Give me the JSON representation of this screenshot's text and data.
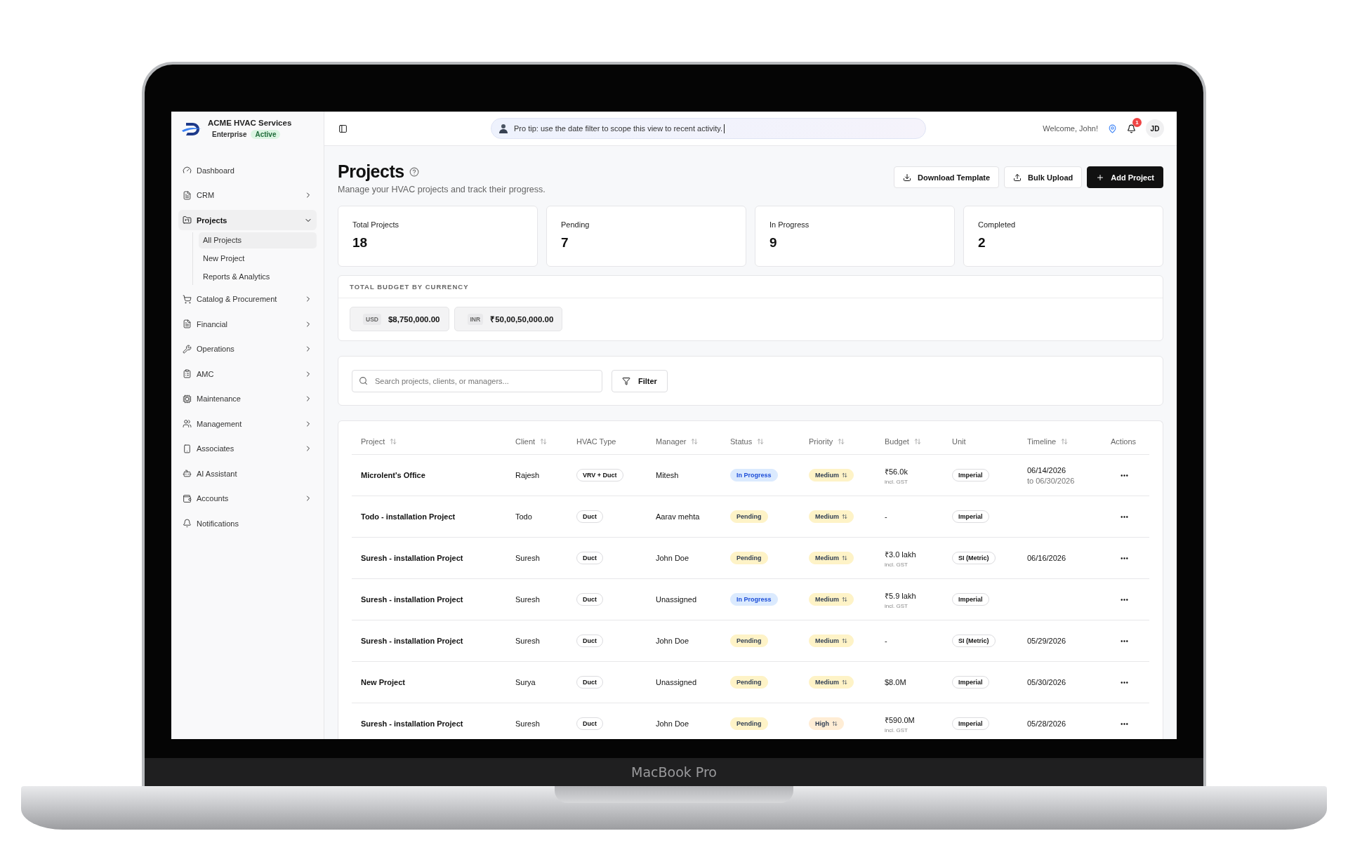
{
  "device": {
    "label": "MacBook Pro"
  },
  "sidebar": {
    "brand": {
      "name": "ACME HVAC Services",
      "plan": "Enterprise",
      "status": "Active"
    },
    "items": [
      {
        "label": "Dashboard",
        "kind": "link"
      },
      {
        "label": "CRM",
        "kind": "group",
        "expanded": false
      },
      {
        "label": "Projects",
        "kind": "group",
        "expanded": true,
        "children": [
          {
            "label": "All Projects",
            "selected": true
          },
          {
            "label": "New Project",
            "selected": false
          },
          {
            "label": "Reports & Analytics",
            "selected": false
          }
        ]
      },
      {
        "label": "Catalog & Procurement",
        "kind": "group",
        "expanded": false
      },
      {
        "label": "Financial",
        "kind": "group",
        "expanded": false
      },
      {
        "label": "Operations",
        "kind": "group",
        "expanded": false
      },
      {
        "label": "AMC",
        "kind": "group",
        "expanded": false
      },
      {
        "label": "Maintenance",
        "kind": "group",
        "expanded": false
      },
      {
        "label": "Management",
        "kind": "group",
        "expanded": false
      },
      {
        "label": "Associates",
        "kind": "group",
        "expanded": false
      },
      {
        "label": "AI Assistant",
        "kind": "link"
      },
      {
        "label": "Accounts",
        "kind": "group",
        "expanded": false
      },
      {
        "label": "Notifications",
        "kind": "link"
      }
    ]
  },
  "topbar": {
    "tip": "Pro tip: use the date filter to scope this view to recent activity.",
    "welcome": "Welcome, John!",
    "notification_count": "1",
    "avatar": "JD"
  },
  "header": {
    "title": "Projects",
    "subtitle": "Manage your HVAC projects and track their progress.",
    "buttons": [
      {
        "label": "Download Template",
        "kind": "download"
      },
      {
        "label": "Bulk Upload",
        "kind": "upload"
      },
      {
        "label": "Add Project",
        "kind": "primary"
      }
    ]
  },
  "stats": [
    {
      "label": "Total Projects",
      "value": "18"
    },
    {
      "label": "Pending",
      "value": "7"
    },
    {
      "label": "In Progress",
      "value": "9"
    },
    {
      "label": "Completed",
      "value": "2"
    }
  ],
  "budget": {
    "title": "TOTAL BUDGET BY CURRENCY",
    "currencies": [
      {
        "code": "USD",
        "amount": "$8,750,000.00"
      },
      {
        "code": "INR",
        "amount": "₹50,00,50,000.00"
      }
    ]
  },
  "search": {
    "placeholder": "Search projects, clients, or managers...",
    "filter": "Filter"
  },
  "table": {
    "columns": [
      {
        "label": "Project",
        "sortable": true
      },
      {
        "label": "Client",
        "sortable": true
      },
      {
        "label": "HVAC Type",
        "sortable": false
      },
      {
        "label": "Manager",
        "sortable": true
      },
      {
        "label": "Status",
        "sortable": true
      },
      {
        "label": "Priority",
        "sortable": true
      },
      {
        "label": "Budget",
        "sortable": true
      },
      {
        "label": "Unit",
        "sortable": false
      },
      {
        "label": "Timeline",
        "sortable": true
      },
      {
        "label": "Actions",
        "sortable": false
      }
    ],
    "rows": [
      {
        "project": "Microlent's Office",
        "client": "Rajesh",
        "hvac_type": "VRV + Duct",
        "manager": "Mitesh",
        "status": {
          "label": "In Progress",
          "color": "#dbeafe"
        },
        "priority": {
          "label": "Medium",
          "color": "#fef3c7"
        },
        "budget": "₹56.0k",
        "budget_note": "incl. GST",
        "unit": "Imperial",
        "timeline": "06/14/2026",
        "timeline_end": "to 06/30/2026"
      },
      {
        "project": "Todo - installation Project",
        "client": "Todo",
        "hvac_type": "Duct",
        "manager": "Aarav mehta",
        "status": {
          "label": "Pending",
          "color": "#fef3c7"
        },
        "priority": {
          "label": "Medium",
          "color": "#fef3c7"
        },
        "budget": "-",
        "unit": "Imperial"
      },
      {
        "project": "Suresh - installation Project",
        "client": "Suresh",
        "hvac_type": "Duct",
        "manager": "John Doe",
        "status": {
          "label": "Pending",
          "color": "#fef3c7"
        },
        "priority": {
          "label": "Medium",
          "color": "#fef3c7"
        },
        "budget": "₹3.0 lakh",
        "budget_note": "incl. GST",
        "unit": "SI (Metric)",
        "timeline": "06/16/2026"
      },
      {
        "project": "Suresh - installation Project",
        "client": "Suresh",
        "hvac_type": "Duct",
        "manager": "Unassigned",
        "status": {
          "label": "In Progress",
          "color": "#dbeafe"
        },
        "priority": {
          "label": "Medium",
          "color": "#fef3c7"
        },
        "budget": "₹5.9 lakh",
        "budget_note": "incl. GST",
        "unit": "Imperial"
      },
      {
        "project": "Suresh - installation Project",
        "client": "Suresh",
        "hvac_type": "Duct",
        "manager": "John Doe",
        "status": {
          "label": "Pending",
          "color": "#fef3c7"
        },
        "priority": {
          "label": "Medium",
          "color": "#fef3c7"
        },
        "budget": "-",
        "unit": "SI (Metric)",
        "timeline": "05/29/2026"
      },
      {
        "project": "New Project",
        "client": "Surya",
        "hvac_type": "Duct",
        "manager": "Unassigned",
        "status": {
          "label": "Pending",
          "color": "#fef3c7"
        },
        "priority": {
          "label": "Medium",
          "color": "#fef3c7"
        },
        "budget": "$8.0M",
        "unit": "Imperial",
        "timeline": "05/30/2026"
      },
      {
        "project": "Suresh - installation Project",
        "client": "Suresh",
        "hvac_type": "Duct",
        "manager": "John Doe",
        "status": {
          "label": "Pending",
          "color": "#fef3c7"
        },
        "priority": {
          "label": "High",
          "color": "#ffedd5"
        },
        "budget": "₹590.0M",
        "budget_note": "incl. GST",
        "unit": "Imperial",
        "timeline": "05/28/2026"
      }
    ]
  }
}
